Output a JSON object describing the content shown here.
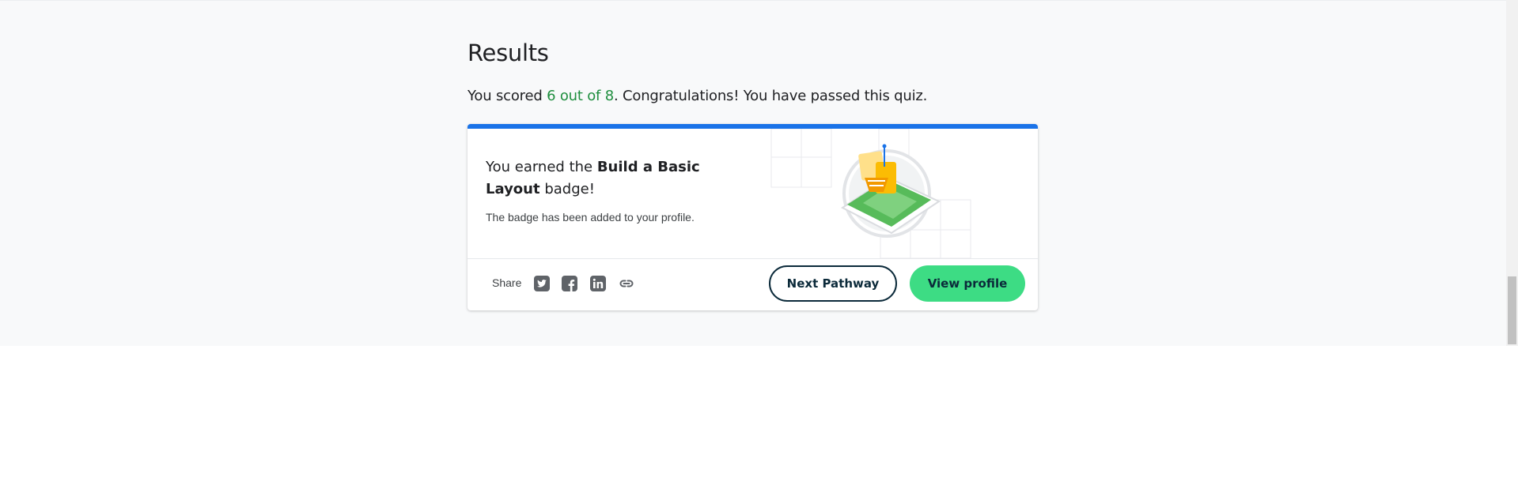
{
  "results": {
    "title": "Results",
    "score_prefix": "You scored ",
    "score": "6 out of 8",
    "score_suffix": ". Congratulations! You have passed this quiz."
  },
  "badge_card": {
    "earned_prefix": "You earned the ",
    "badge_name": "Build a Basic Layout",
    "earned_suffix": " badge!",
    "subtext": "The badge has been added to your profile.",
    "accent_color": "#1a73e8"
  },
  "share": {
    "label": "Share",
    "icons": [
      "twitter-icon",
      "facebook-icon",
      "linkedin-icon",
      "link-icon"
    ]
  },
  "buttons": {
    "next_pathway": "Next Pathway",
    "view_profile": "View profile",
    "view_profile_color": "#3ddc84"
  },
  "colors": {
    "score_green": "#1e8e3e",
    "panel_background": "#f8f9fa"
  }
}
